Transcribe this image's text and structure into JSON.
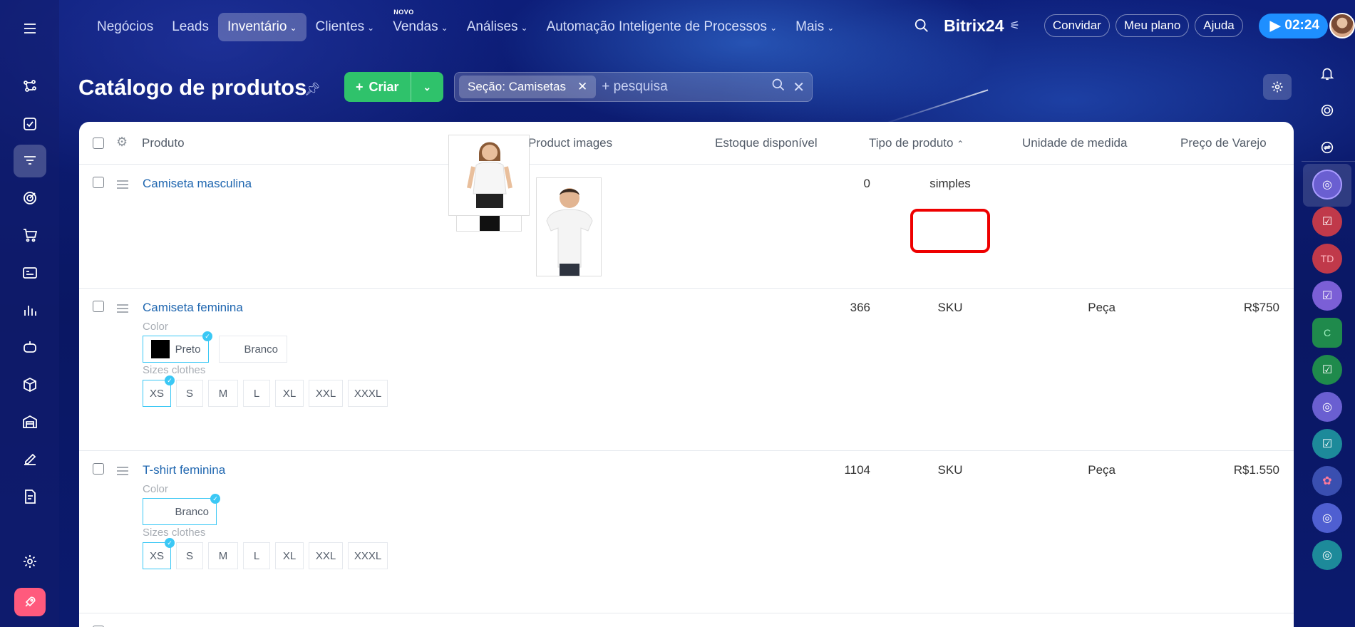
{
  "nav": {
    "items": [
      {
        "label": "Negócios"
      },
      {
        "label": "Leads"
      },
      {
        "label": "Inventário",
        "chev": "⌄",
        "active": true
      },
      {
        "label": "Clientes",
        "chev": "⌄"
      },
      {
        "label": "Vendas",
        "chev": "⌄",
        "badge": "NOVO"
      },
      {
        "label": "Análises",
        "chev": "⌄"
      },
      {
        "label": "Automação Inteligente de Processos",
        "chev": "⌄"
      },
      {
        "label": "Mais",
        "chev": "⌄"
      }
    ]
  },
  "header": {
    "brand": "Bitrix24",
    "invite": "Convidar",
    "plan": "Meu plano",
    "help": "Ajuda",
    "timer": "02:24"
  },
  "page": {
    "title": "Catálogo de produtos",
    "create": "Criar",
    "filter_chip": "Seção: Camisetas",
    "search_placeholder": "+ pesquisa"
  },
  "table": {
    "headers": {
      "product": "Produto",
      "images": "Product images",
      "stock": "Estoque disponível",
      "type": "Tipo de produto",
      "unit": "Unidade de medida",
      "price": "Preço de Varejo"
    },
    "rows": [
      {
        "name": "Camiseta masculina",
        "stock": "0",
        "type": "simples",
        "unit": "",
        "price": ""
      },
      {
        "name": "Camiseta feminina",
        "stock": "366",
        "type": "SKU",
        "unit": "Peça",
        "price": "R$750",
        "color_label": "Color",
        "colors": [
          "Preto",
          "Branco"
        ],
        "sizes_label": "Sizes clothes",
        "sizes": [
          "XS",
          "S",
          "M",
          "L",
          "XL",
          "XXL",
          "XXXL"
        ]
      },
      {
        "name": "T-shirt feminina",
        "stock": "1104",
        "type": "SKU",
        "unit": "Peça",
        "price": "R$1.550",
        "color_label": "Color",
        "colors": [
          "Branco"
        ],
        "sizes_label": "Sizes clothes",
        "sizes": [
          "XS",
          "S",
          "M",
          "L",
          "XL",
          "XXL",
          "XXXL"
        ]
      }
    ]
  },
  "right_sidebar": {
    "avatar_initials": "TD",
    "chat_letter": "C"
  },
  "colors": {
    "accent": "#2fc26b",
    "link": "#2067b0",
    "highlight": "#ee0000",
    "timer": "#1e8fff"
  }
}
